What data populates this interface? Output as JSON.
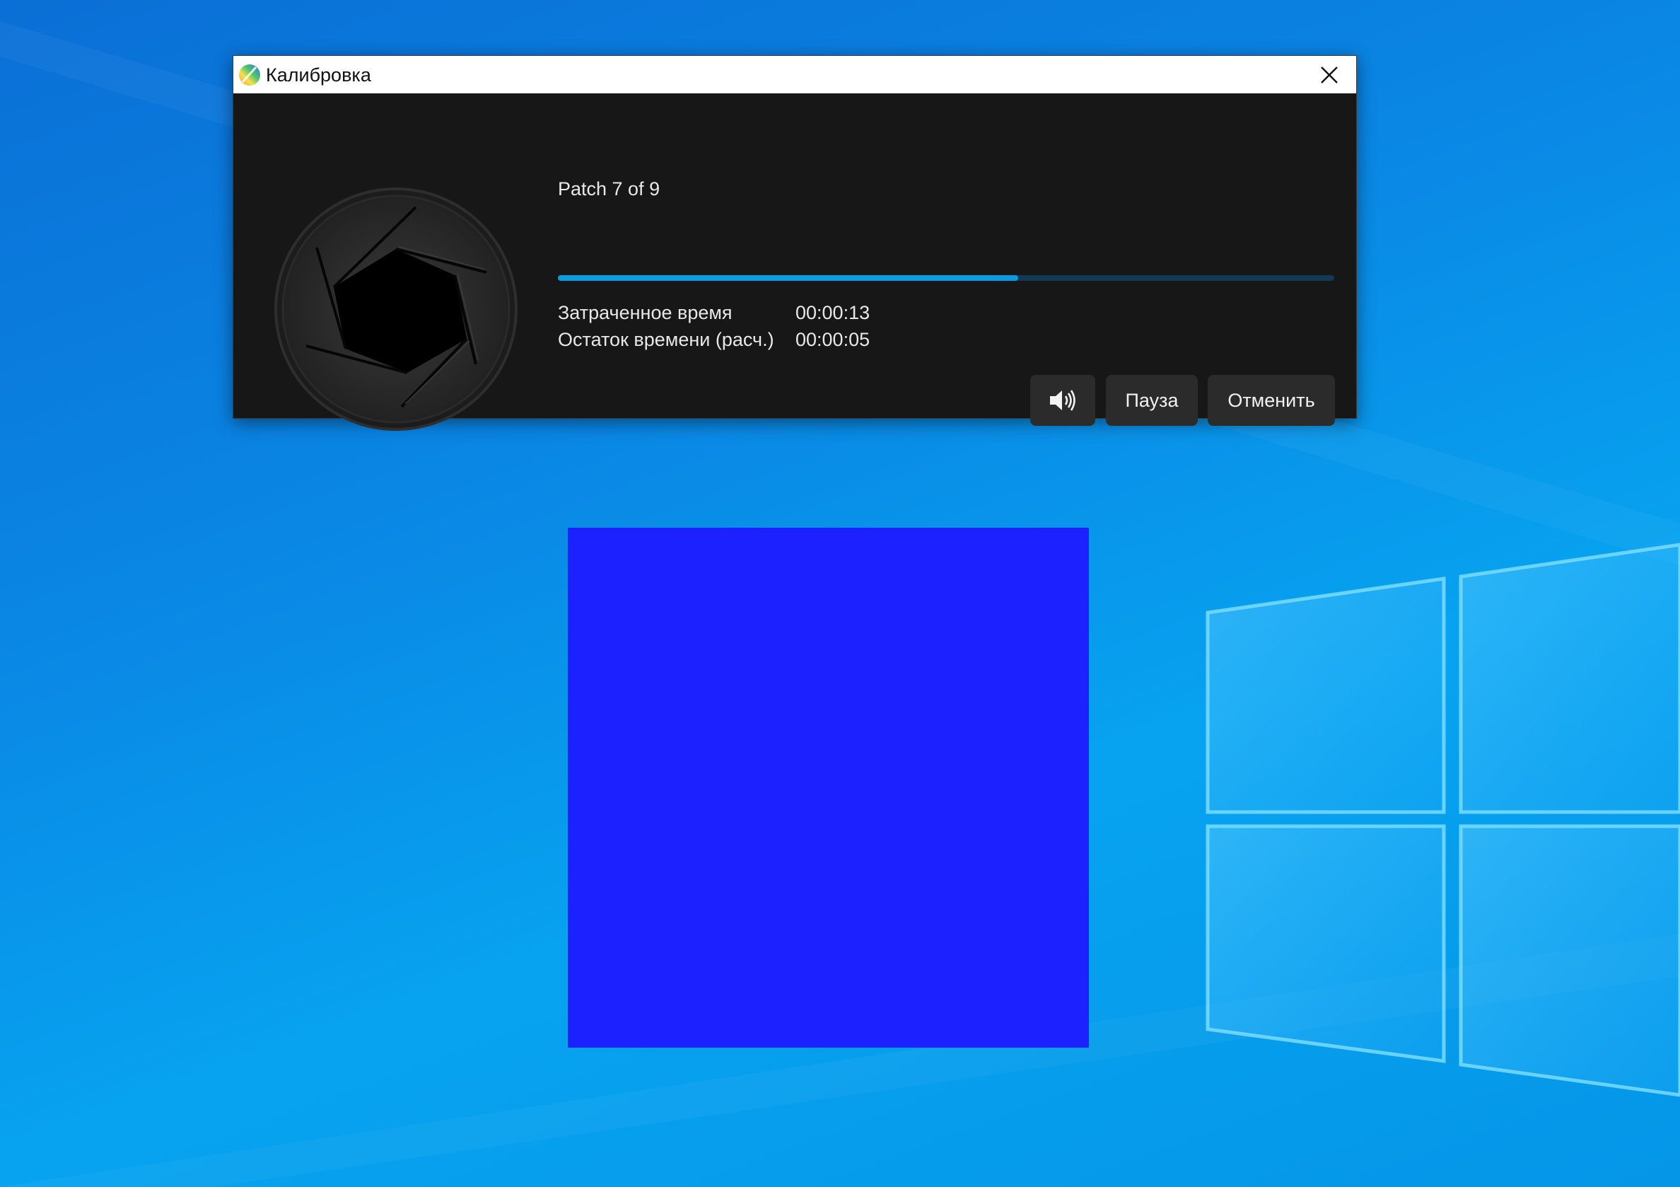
{
  "window": {
    "title": "Калибровка",
    "close_icon": "close-icon",
    "app_icon": "calibration-app-icon"
  },
  "calibration": {
    "patch_label": "Patch 7 of 9",
    "progress": 0.593,
    "elapsed_label": "Затраченное время",
    "elapsed_value": "00:00:13",
    "remaining_label": "Остаток времени (расч.)",
    "remaining_value": "00:00:05"
  },
  "buttons": {
    "sound_icon": "speaker-icon",
    "pause_label": "Пауза",
    "cancel_label": "Отменить"
  },
  "patch": {
    "color": "#1b21ff"
  },
  "colors": {
    "window_bg": "#171717",
    "progress_fill": "#0b9be0",
    "progress_track": "#123a53",
    "button_bg": "#2b2b2b"
  }
}
